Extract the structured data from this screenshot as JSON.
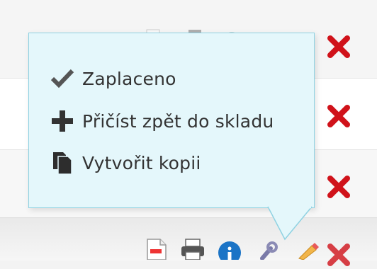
{
  "menu": {
    "items": [
      {
        "label": "Zaplaceno",
        "icon": "checkmark-icon"
      },
      {
        "label": "Přičíst zpět do skladu",
        "icon": "plus-icon"
      },
      {
        "label": "Vytvořit kopii",
        "icon": "copy-icon"
      }
    ]
  },
  "colors": {
    "bubble_bg": "#e4f7fb",
    "bubble_border": "#8fd2e2",
    "delete_red": "#d0121a",
    "text": "#333333"
  },
  "row_icons": [
    "document-icon",
    "printer-icon",
    "info-icon",
    "wrench-icon",
    "pencil-icon",
    "delete-icon"
  ]
}
